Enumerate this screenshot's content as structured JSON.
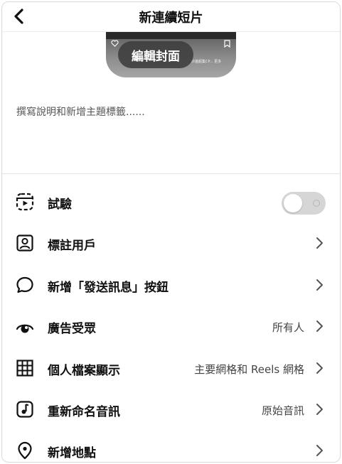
{
  "header": {
    "title": "新連續短片"
  },
  "cover": {
    "edit_label": "編輯封面",
    "tiny_text": "沙邊超集CP... 更多"
  },
  "caption": {
    "placeholder": "撰寫說明和新增主題標籤......"
  },
  "settings": {
    "trial": {
      "label": "試驗",
      "enabled": false
    },
    "tag_people": {
      "label": "標註用戶"
    },
    "message_button": {
      "label": "新增「發送訊息」按鈕"
    },
    "audience": {
      "label": "廣告受眾",
      "value": "所有人"
    },
    "profile_display": {
      "label": "個人檔案顯示",
      "value": "主要網格和 Reels 網格"
    },
    "rename_audio": {
      "label": "重新命名音訊",
      "value": "原始音訊"
    },
    "location": {
      "label": "新增地點"
    }
  },
  "icons": {
    "back": "chevron-left-icon",
    "trial": "reels-icon",
    "tag_people": "person-tag-icon",
    "message_button": "speech-bubble-icon",
    "audience": "eye-icon",
    "profile_display": "grid-icon",
    "rename_audio": "music-note-icon",
    "location": "location-pin-icon",
    "chevron": "chevron-right-icon"
  }
}
